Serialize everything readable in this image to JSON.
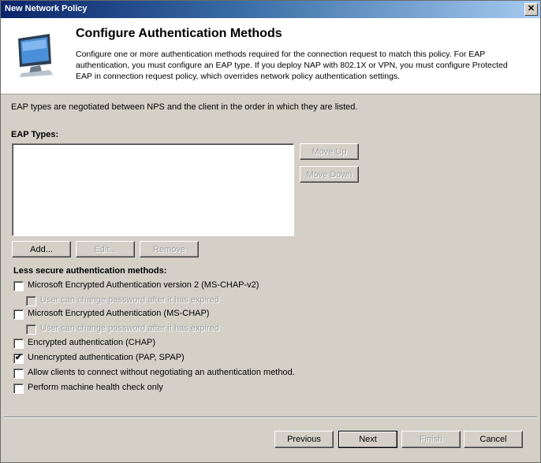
{
  "window": {
    "title": "New Network Policy",
    "close_label": "✕"
  },
  "header": {
    "title": "Configure Authentication Methods",
    "description": "Configure one or more authentication methods required for the connection request to match this policy. For EAP authentication, you must configure an EAP type. If you deploy NAP with 802.1X or VPN, you must configure Protected EAP in connection request policy, which overrides network policy authentication settings."
  },
  "info_text": "EAP types are negotiated between NPS and the client in the order in which they are listed.",
  "eap": {
    "label": "EAP Types:",
    "move_up": "Move Up",
    "move_down": "Move Down",
    "add": "Add...",
    "edit": "Edit...",
    "remove": "Remove"
  },
  "less_secure_label": "Less secure authentication methods:",
  "options": [
    {
      "label": "Microsoft Encrypted Authentication version 2 (MS-CHAP-v2)",
      "checked": false
    },
    {
      "label": "User can change password after it has expired",
      "checked": false
    },
    {
      "label": "Microsoft Encrypted Authentication (MS-CHAP)",
      "checked": false
    },
    {
      "label": "User can change password after it has expired",
      "checked": false
    },
    {
      "label": "Encrypted authentication (CHAP)",
      "checked": false
    },
    {
      "label": "Unencrypted authentication (PAP, SPAP)",
      "checked": true
    },
    {
      "label": "Allow clients to connect without negotiating an authentication method.",
      "checked": false
    },
    {
      "label": "Perform machine health check only",
      "checked": false
    }
  ],
  "footer": {
    "previous": "Previous",
    "next": "Next",
    "finish": "Finish",
    "cancel": "Cancel"
  },
  "check_glyph": "✔"
}
